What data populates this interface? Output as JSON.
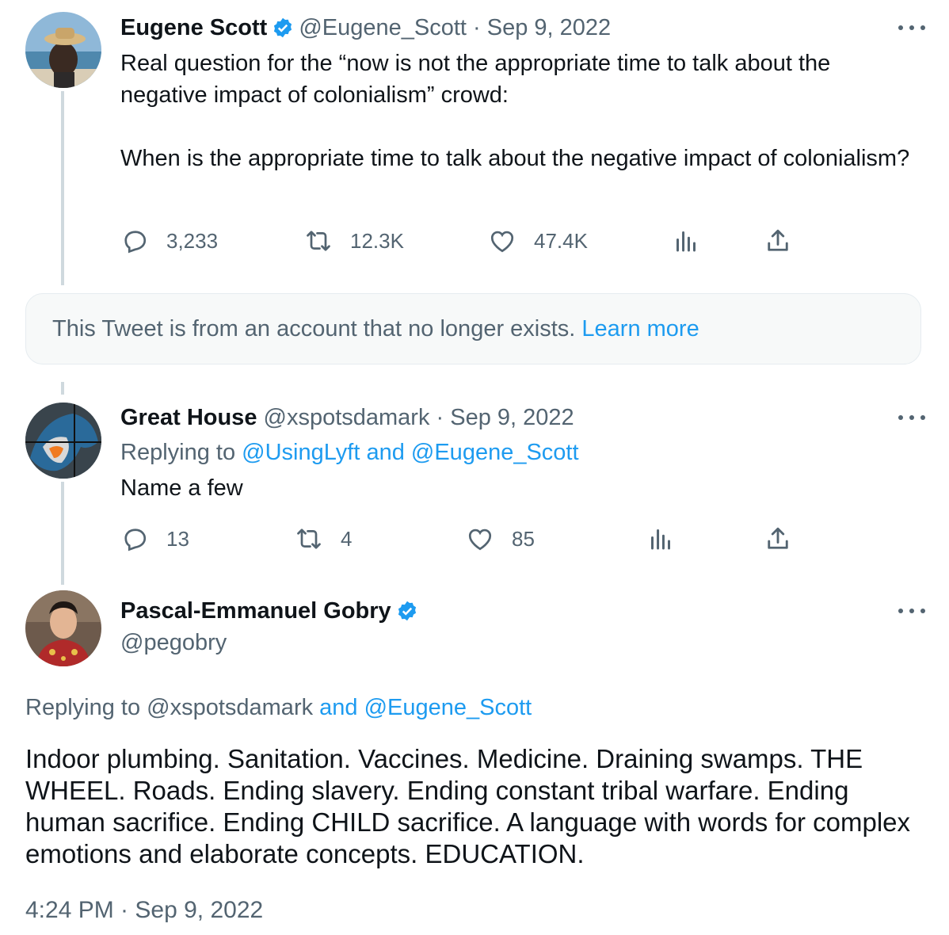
{
  "tweets": [
    {
      "name": "Eugene Scott",
      "handle": "@Eugene_Scott",
      "dot": "·",
      "date": "Sep 9, 2022",
      "verified": true,
      "text": "Real question for the “now is not the appropriate time to talk about the negative impact of colonialism” crowd:\n\nWhen is the appropriate time to talk about the negative impact of colonialism?",
      "replies": "3,233",
      "retweets": "12.3K",
      "likes": "47.4K"
    },
    {
      "name": "Great House",
      "handle": "@xspotsdamark",
      "dot": "·",
      "date": "Sep 9, 2022",
      "replying_prefix": "Replying to ",
      "replying_targets": "@UsingLyft and @Eugene_Scott",
      "text": "Name a few",
      "replies": "13",
      "retweets": "4",
      "likes": "85"
    }
  ],
  "notice": {
    "text": "This Tweet is from an account that no longer exists. ",
    "link": "Learn more"
  },
  "main": {
    "name": "Pascal-Emmanuel Gobry",
    "handle": "@pegobry",
    "verified": true,
    "replying_prefix": "Replying to @xspotsdamark ",
    "replying_targets": "and @Eugene_Scott",
    "text": "Indoor plumbing. Sanitation. Vaccines. Medicine. Draining swamps. THE WHEEL. Roads. Ending slavery. Ending constant tribal warfare. Ending human sacrifice. Ending CHILD sacrifice. A language with words for complex emotions and elaborate concepts. EDUCATION.",
    "timestamp": "4:24 PM · Sep 9, 2022"
  },
  "colors": {
    "accent": "#1d9bf0",
    "secondary_text": "#536471",
    "primary_text": "#0f1419",
    "thread_line": "#cfd9de"
  },
  "icons": [
    "more-icon",
    "verified-badge-icon",
    "reply-icon",
    "retweet-icon",
    "like-icon",
    "views-icon",
    "share-icon"
  ]
}
